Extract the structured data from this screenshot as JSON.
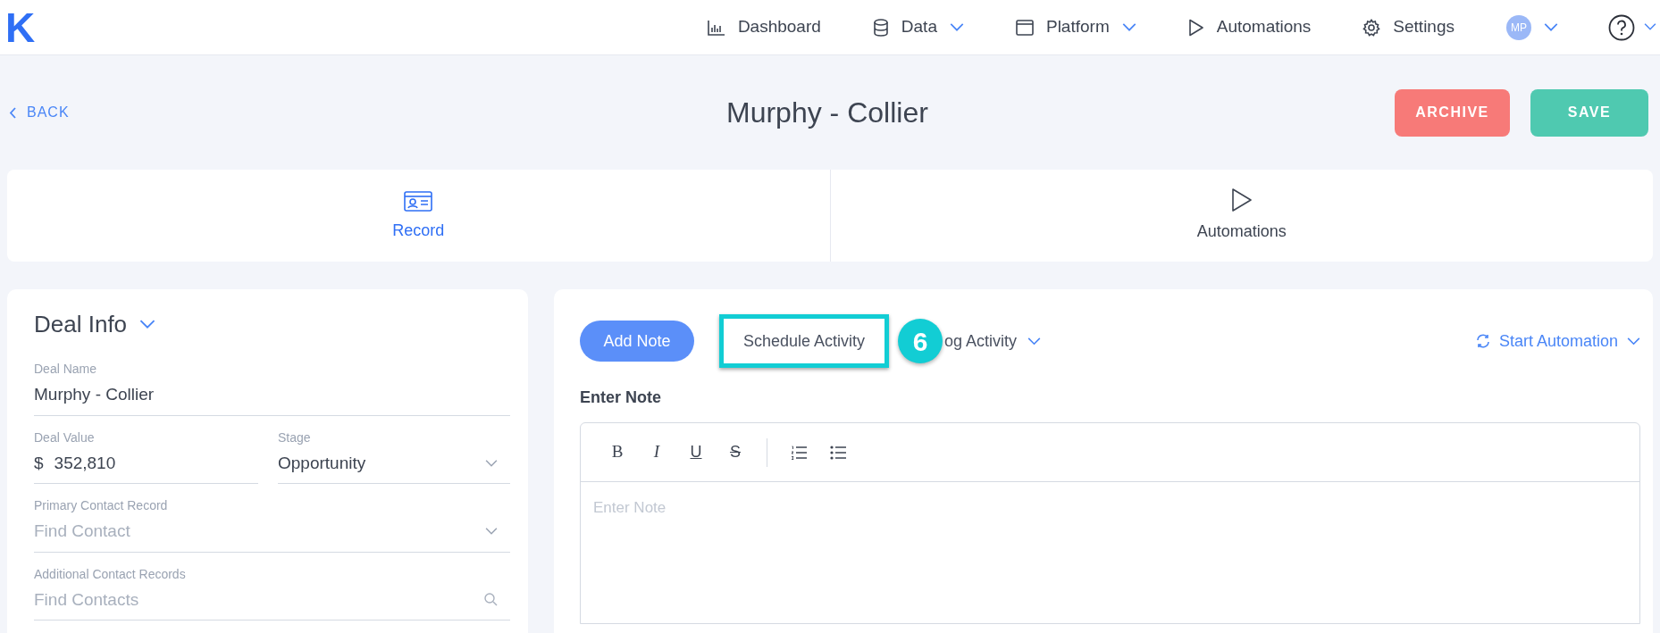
{
  "logo": "K",
  "nav": [
    {
      "label": "Dashboard",
      "kind": "chart",
      "dropdown": false
    },
    {
      "label": "Data",
      "kind": "database",
      "dropdown": true
    },
    {
      "label": "Platform",
      "kind": "window",
      "dropdown": true
    },
    {
      "label": "Automations",
      "kind": "play",
      "dropdown": false
    },
    {
      "label": "Settings",
      "kind": "gear",
      "dropdown": false
    }
  ],
  "avatar": "MP",
  "back": "BACK",
  "title": "Murphy - Collier",
  "actions": [
    {
      "label": "ARCHIVE",
      "kind": "danger"
    },
    {
      "label": "SAVE",
      "kind": "success"
    }
  ],
  "tabs": [
    {
      "label": "Record",
      "kind": "card",
      "selected": true
    },
    {
      "label": "Automations",
      "kind": "play",
      "selected": false
    }
  ],
  "deal_info": {
    "title": "Deal Info",
    "fields": [
      {
        "label": "Deal Name",
        "value": "Murphy - Collier",
        "kind": "text"
      },
      {
        "label": "Deal Value",
        "prefix": "$",
        "value": "352,810",
        "kind": "money",
        "label2": "Stage",
        "value2": "Opportunity"
      },
      {
        "label": "Primary Contact Record",
        "placeholder": "Find Contact",
        "kind": "select"
      },
      {
        "label": "Additional Contact Records",
        "placeholder": "Find Contacts",
        "kind": "search"
      }
    ]
  },
  "activity": {
    "add_note": "Add Note",
    "schedule": "Schedule Activity",
    "badge": "6",
    "log": "og Activity",
    "start": "Start Automation",
    "note_label": "Enter Note",
    "note_placeholder": "Enter Note",
    "format_buttons": [
      {
        "label": "B",
        "kind": "bold"
      },
      {
        "label": "I",
        "kind": "italic"
      },
      {
        "label": "U",
        "kind": "underline"
      },
      {
        "label": "S",
        "kind": "strike"
      },
      {
        "kind": "ordered"
      },
      {
        "kind": "bullet"
      }
    ]
  }
}
